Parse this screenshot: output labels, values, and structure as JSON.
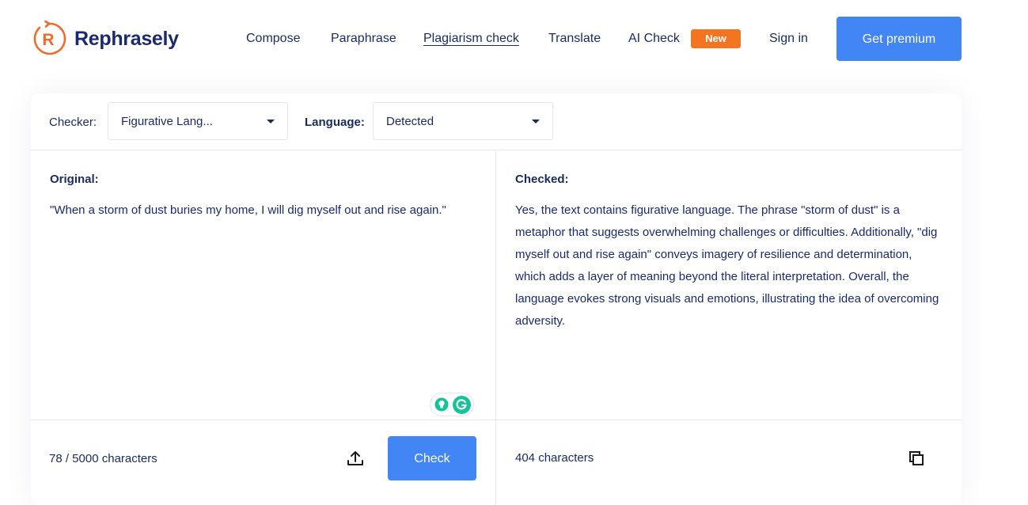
{
  "brand": {
    "name": "Rephrasely",
    "logo_letter": "R",
    "accent_color": "#f06a2a",
    "text_color": "#1a2a6c"
  },
  "nav": {
    "items": [
      {
        "label": "Compose",
        "active": false
      },
      {
        "label": "Paraphrase",
        "active": false
      },
      {
        "label": "Plagiarism check",
        "active": true
      },
      {
        "label": "Translate",
        "active": false
      },
      {
        "label": "AI Check",
        "active": false
      }
    ],
    "new_badge": "New",
    "sign_in": "Sign in",
    "premium_button": "Get premium"
  },
  "toolbar": {
    "checker_label": "Checker:",
    "checker_value": "Figurative Lang...",
    "language_label": "Language:",
    "language_value": "Detected"
  },
  "original": {
    "title": "Original:",
    "text": "\"When a storm of dust buries my home, I will dig myself out and rise again.\"",
    "char_count": "78 / 5000 characters",
    "check_button": "Check"
  },
  "checked": {
    "title": "Checked:",
    "text": "Yes, the text contains figurative language. The phrase \"storm of dust\" is a metaphor that suggests overwhelming challenges or difficulties. Additionally, \"dig myself out and rise again\" conveys imagery of resilience and determination, which adds a layer of meaning beyond the literal interpretation. Overall, the language evokes strong visuals and emotions, illustrating the idea of overcoming adversity.",
    "char_count": "404 characters"
  },
  "colors": {
    "primary_button": "#4285f4",
    "badge": "#f47521",
    "grammarly": "#15c39a"
  },
  "icons": {
    "logo": "circular-arrow-r-icon",
    "upload": "upload-icon",
    "copy": "copy-icon",
    "grammarly_bulb": "lightbulb-icon",
    "grammarly_logo": "grammarly-g-icon"
  }
}
